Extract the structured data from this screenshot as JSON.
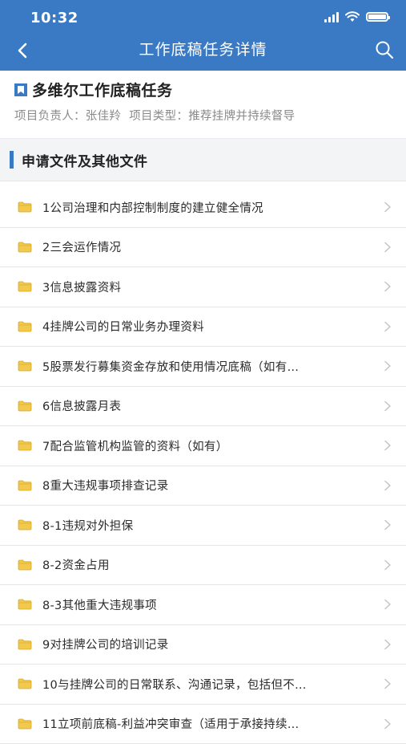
{
  "status_bar": {
    "time": "10:32"
  },
  "nav": {
    "title": "工作底稿任务详情"
  },
  "header": {
    "title": "多维尔工作底稿任务",
    "owner_text": "项目负责人：张佳羚",
    "type_text": "项目类型：推荐挂牌并持续督导"
  },
  "section": {
    "title": "申请文件及其他文件"
  },
  "items": [
    {
      "label": "1公司治理和内部控制制度的建立健全情况"
    },
    {
      "label": "2三会运作情况"
    },
    {
      "label": "3信息披露资料"
    },
    {
      "label": "4挂牌公司的日常业务办理资料"
    },
    {
      "label": "5股票发行募集资金存放和使用情况底稿（如有…"
    },
    {
      "label": "6信息披露月表"
    },
    {
      "label": "7配合监管机构监管的资料（如有）"
    },
    {
      "label": "8重大违规事项排查记录"
    },
    {
      "label": "8-1违规对外担保"
    },
    {
      "label": "8-2资金占用"
    },
    {
      "label": "8-3其他重大违规事项"
    },
    {
      "label": "9对挂牌公司的培训记录"
    },
    {
      "label": "10与挂牌公司的日常联系、沟通记录，包括但不…"
    },
    {
      "label": "11立项前底稿-利益冲突审查（适用于承接持续…"
    }
  ],
  "colors": {
    "brand": "#3a79c4",
    "folder": "#f1c94f"
  },
  "icons": [
    "back-arrow-icon",
    "search-icon",
    "bookmark-icon",
    "folder-icon",
    "chevron-right-icon"
  ]
}
